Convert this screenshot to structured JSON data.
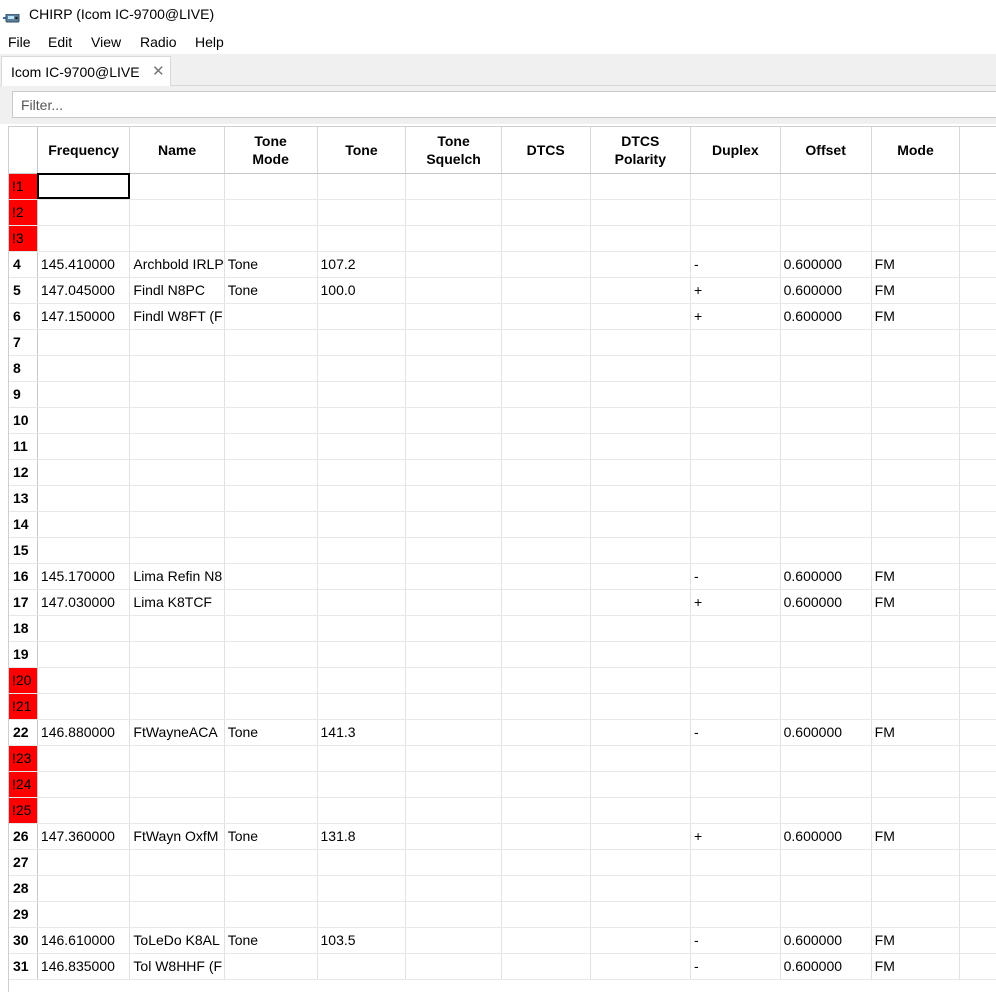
{
  "window": {
    "title": "CHIRP (Icom IC-9700@LIVE)",
    "icon": "radio-app-icon"
  },
  "menu": [
    "File",
    "Edit",
    "View",
    "Radio",
    "Help"
  ],
  "tab": {
    "label": "Icom IC-9700@LIVE",
    "close": "✕"
  },
  "filter": {
    "placeholder": "Filter...",
    "value": ""
  },
  "columns": [
    "Frequency",
    "Name",
    "Tone Mode",
    "Tone",
    "Tone Squelch",
    "DTCS",
    "DTCS Polarity",
    "Duplex",
    "Offset",
    "Mode"
  ],
  "rows": [
    {
      "num": "!1",
      "error": true,
      "cells": [
        "",
        "",
        "",
        "",
        "",
        "",
        "",
        "",
        "",
        "",
        ""
      ]
    },
    {
      "num": "!2",
      "error": true,
      "cells": [
        "",
        "",
        "",
        "",
        "",
        "",
        "",
        "",
        "",
        "",
        ""
      ]
    },
    {
      "num": "!3",
      "error": true,
      "cells": [
        "",
        "",
        "",
        "",
        "",
        "",
        "",
        "",
        "",
        "",
        ""
      ]
    },
    {
      "num": "4",
      "error": false,
      "cells": [
        "145.410000",
        "Archbold IRLP",
        "Tone",
        "107.2",
        "",
        "",
        "",
        "-",
        "0.600000",
        "FM",
        ""
      ]
    },
    {
      "num": "5",
      "error": false,
      "cells": [
        "147.045000",
        "Findl N8PC",
        "Tone",
        "100.0",
        "",
        "",
        "",
        "+",
        "0.600000",
        "FM",
        ""
      ]
    },
    {
      "num": "6",
      "error": false,
      "cells": [
        "147.150000",
        "Findl W8FT (F",
        "",
        "",
        "",
        "",
        "",
        "+",
        "0.600000",
        "FM",
        ""
      ]
    },
    {
      "num": "7",
      "error": false,
      "cells": [
        "",
        "",
        "",
        "",
        "",
        "",
        "",
        "",
        "",
        "",
        ""
      ]
    },
    {
      "num": "8",
      "error": false,
      "cells": [
        "",
        "",
        "",
        "",
        "",
        "",
        "",
        "",
        "",
        "",
        ""
      ]
    },
    {
      "num": "9",
      "error": false,
      "cells": [
        "",
        "",
        "",
        "",
        "",
        "",
        "",
        "",
        "",
        "",
        ""
      ]
    },
    {
      "num": "10",
      "error": false,
      "cells": [
        "",
        "",
        "",
        "",
        "",
        "",
        "",
        "",
        "",
        "",
        ""
      ]
    },
    {
      "num": "11",
      "error": false,
      "cells": [
        "",
        "",
        "",
        "",
        "",
        "",
        "",
        "",
        "",
        "",
        ""
      ]
    },
    {
      "num": "12",
      "error": false,
      "cells": [
        "",
        "",
        "",
        "",
        "",
        "",
        "",
        "",
        "",
        "",
        ""
      ]
    },
    {
      "num": "13",
      "error": false,
      "cells": [
        "",
        "",
        "",
        "",
        "",
        "",
        "",
        "",
        "",
        "",
        ""
      ]
    },
    {
      "num": "14",
      "error": false,
      "cells": [
        "",
        "",
        "",
        "",
        "",
        "",
        "",
        "",
        "",
        "",
        ""
      ]
    },
    {
      "num": "15",
      "error": false,
      "cells": [
        "",
        "",
        "",
        "",
        "",
        "",
        "",
        "",
        "",
        "",
        ""
      ]
    },
    {
      "num": "16",
      "error": false,
      "cells": [
        "145.170000",
        "Lima Refin N8",
        "",
        "",
        "",
        "",
        "",
        "-",
        "0.600000",
        "FM",
        ""
      ]
    },
    {
      "num": "17",
      "error": false,
      "cells": [
        "147.030000",
        "Lima K8TCF",
        "",
        "",
        "",
        "",
        "",
        "+",
        "0.600000",
        "FM",
        ""
      ]
    },
    {
      "num": "18",
      "error": false,
      "cells": [
        "",
        "",
        "",
        "",
        "",
        "",
        "",
        "",
        "",
        "",
        ""
      ]
    },
    {
      "num": "19",
      "error": false,
      "cells": [
        "",
        "",
        "",
        "",
        "",
        "",
        "",
        "",
        "",
        "",
        ""
      ]
    },
    {
      "num": "!20",
      "error": true,
      "cells": [
        "",
        "",
        "",
        "",
        "",
        "",
        "",
        "",
        "",
        "",
        ""
      ]
    },
    {
      "num": "!21",
      "error": true,
      "cells": [
        "",
        "",
        "",
        "",
        "",
        "",
        "",
        "",
        "",
        "",
        ""
      ]
    },
    {
      "num": "22",
      "error": false,
      "cells": [
        "146.880000",
        "FtWayneACA",
        "Tone",
        "141.3",
        "",
        "",
        "",
        "-",
        "0.600000",
        "FM",
        ""
      ]
    },
    {
      "num": "!23",
      "error": true,
      "cells": [
        "",
        "",
        "",
        "",
        "",
        "",
        "",
        "",
        "",
        "",
        ""
      ]
    },
    {
      "num": "!24",
      "error": true,
      "cells": [
        "",
        "",
        "",
        "",
        "",
        "",
        "",
        "",
        "",
        "",
        ""
      ]
    },
    {
      "num": "!25",
      "error": true,
      "cells": [
        "",
        "",
        "",
        "",
        "",
        "",
        "",
        "",
        "",
        "",
        ""
      ]
    },
    {
      "num": "26",
      "error": false,
      "cells": [
        "147.360000",
        "FtWayn OxfM",
        "Tone",
        "131.8",
        "",
        "",
        "",
        "+",
        "0.600000",
        "FM",
        ""
      ]
    },
    {
      "num": "27",
      "error": false,
      "cells": [
        "",
        "",
        "",
        "",
        "",
        "",
        "",
        "",
        "",
        "",
        ""
      ]
    },
    {
      "num": "28",
      "error": false,
      "cells": [
        "",
        "",
        "",
        "",
        "",
        "",
        "",
        "",
        "",
        "",
        ""
      ]
    },
    {
      "num": "29",
      "error": false,
      "cells": [
        "",
        "",
        "",
        "",
        "",
        "",
        "",
        "",
        "",
        "",
        ""
      ]
    },
    {
      "num": "30",
      "error": false,
      "cells": [
        "146.610000",
        "ToLeDo K8AL",
        "Tone",
        "103.5",
        "",
        "",
        "",
        "-",
        "0.600000",
        "FM",
        ""
      ]
    },
    {
      "num": "31",
      "error": false,
      "cells": [
        "146.835000",
        "Tol W8HHF (F",
        "",
        "",
        "",
        "",
        "",
        "-",
        "0.600000",
        "FM",
        ""
      ]
    }
  ],
  "selected": {
    "row": 0,
    "col": 0
  },
  "colors": {
    "error_row": "#ff0000",
    "selection_border": "#000000"
  }
}
